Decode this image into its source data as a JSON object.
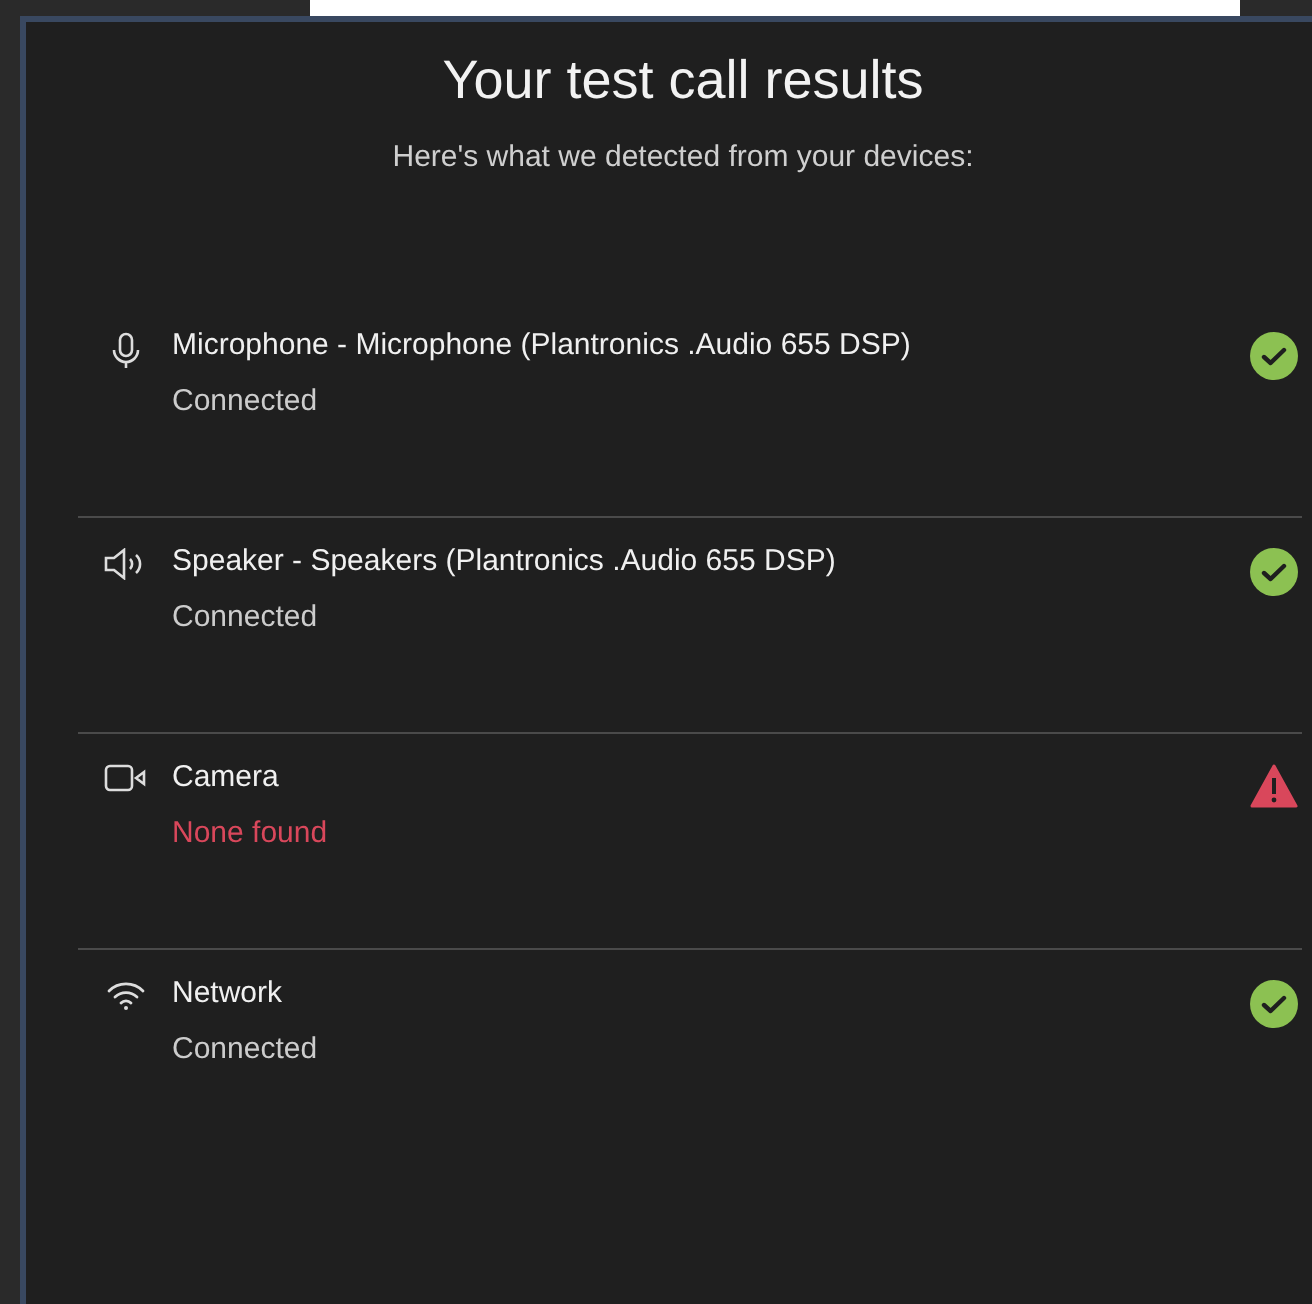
{
  "dialog": {
    "title": "Your test call results",
    "subtitle": "Here's what we detected from your devices:"
  },
  "devices": [
    {
      "kind": "microphone",
      "name": "Microphone - Microphone (Plantronics .Audio 655 DSP)",
      "status_text": "Connected",
      "problem": false
    },
    {
      "kind": "speaker",
      "name": "Speaker - Speakers (Plantronics .Audio 655 DSP)",
      "status_text": "Connected",
      "problem": false
    },
    {
      "kind": "camera",
      "name": "Camera",
      "status_text": "None found",
      "problem": true
    },
    {
      "kind": "network",
      "name": "Network",
      "status_text": "Connected",
      "problem": false
    }
  ]
}
